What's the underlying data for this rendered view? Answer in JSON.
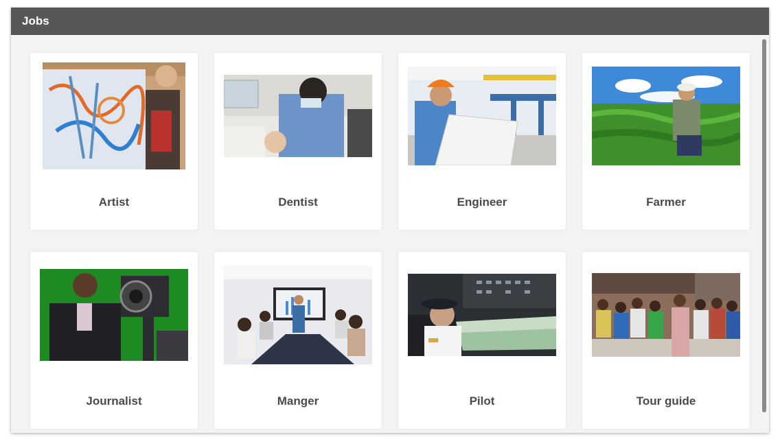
{
  "window": {
    "title": "Jobs"
  },
  "jobs": [
    {
      "label": "Artist"
    },
    {
      "label": "Dentist"
    },
    {
      "label": "Engineer"
    },
    {
      "label": "Farmer"
    },
    {
      "label": "Journalist"
    },
    {
      "label": "Manger"
    },
    {
      "label": "Pilot"
    },
    {
      "label": "Tour guide"
    }
  ],
  "colors": {
    "titlebar": "#575757",
    "background": "#f3f3f3",
    "card": "#ffffff",
    "label_text": "#4a4a4a"
  }
}
